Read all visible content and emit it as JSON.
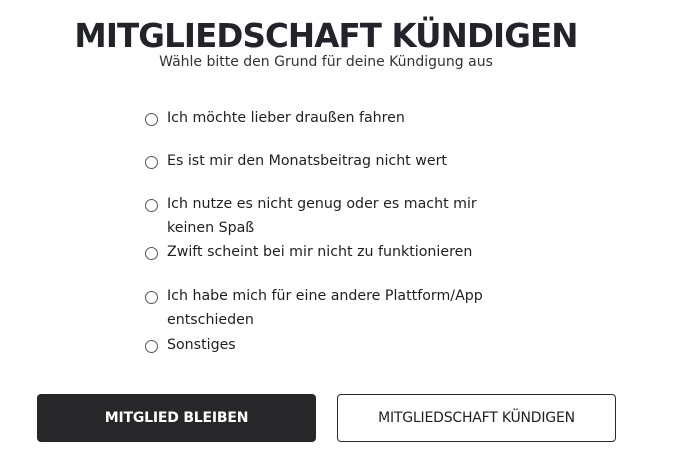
{
  "header": {
    "title": "MITGLIEDSCHAFT KÜNDIGEN",
    "subtitle": "Wähle bitte den Grund für deine Kündigung aus"
  },
  "reasons": [
    {
      "label": "Ich möchte lieber draußen fahren",
      "selected": false
    },
    {
      "label": "Es ist mir den Monatsbeitrag nicht wert",
      "selected": false
    },
    {
      "label": "Ich nutze es nicht genug oder es macht mir keinen Spaß",
      "selected": false
    },
    {
      "label": "Zwift scheint bei mir nicht zu funktionieren",
      "selected": false
    },
    {
      "label": "Ich habe mich für eine andere Plattform/App entschieden",
      "selected": false
    },
    {
      "label": "Sonstiges",
      "selected": false
    }
  ],
  "actions": {
    "stay_label": "MITGLIED BLEIBEN",
    "cancel_label": "MITGLIEDSCHAFT KÜNDIGEN"
  },
  "colors": {
    "primary_button_bg": "#27272a",
    "title_color": "#23232a"
  },
  "icons": {
    "radio": "radio-unchecked-icon"
  }
}
